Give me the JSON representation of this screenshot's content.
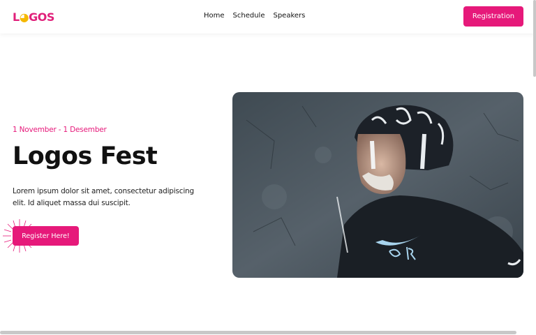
{
  "brand": {
    "logo_text": "LOGOS",
    "accent_color": "#e6197a",
    "bulb_color": "#f5b800"
  },
  "nav": {
    "items": [
      {
        "label": "Home"
      },
      {
        "label": "Schedule"
      },
      {
        "label": "Speakers"
      }
    ],
    "registration_label": "Registration"
  },
  "hero": {
    "date": "1 November - 1 Desember",
    "title": "Logos Fest",
    "description": "Lorem ipsum dolor sit amet, consectetur adipiscing elit. Id aliquet massa dui suscipit.",
    "cta_label": "Register Here!",
    "image_icon": "graffiti-portrait-image"
  }
}
